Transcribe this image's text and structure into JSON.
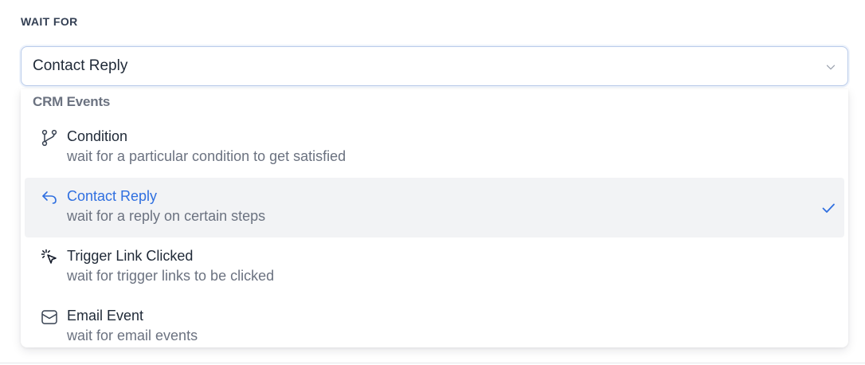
{
  "field": {
    "label": "WAIT FOR",
    "selected_value": "Contact Reply"
  },
  "dropdown": {
    "group_label": "CRM Events",
    "options": [
      {
        "title": "Condition",
        "description": "wait for a particular condition to get satisfied",
        "icon": "git-branch-icon",
        "selected": false
      },
      {
        "title": "Contact Reply",
        "description": "wait for a reply on certain steps",
        "icon": "reply-arrow-icon",
        "selected": true
      },
      {
        "title": "Trigger Link Clicked",
        "description": "wait for trigger links to be clicked",
        "icon": "cursor-click-icon",
        "selected": false
      },
      {
        "title": "Email Event",
        "description": "wait for email events",
        "icon": "envelope-icon",
        "selected": false
      }
    ]
  },
  "colors": {
    "accent": "#2f6fe0",
    "selected_bg": "#f2f3f5",
    "muted_text": "#6b7280"
  }
}
